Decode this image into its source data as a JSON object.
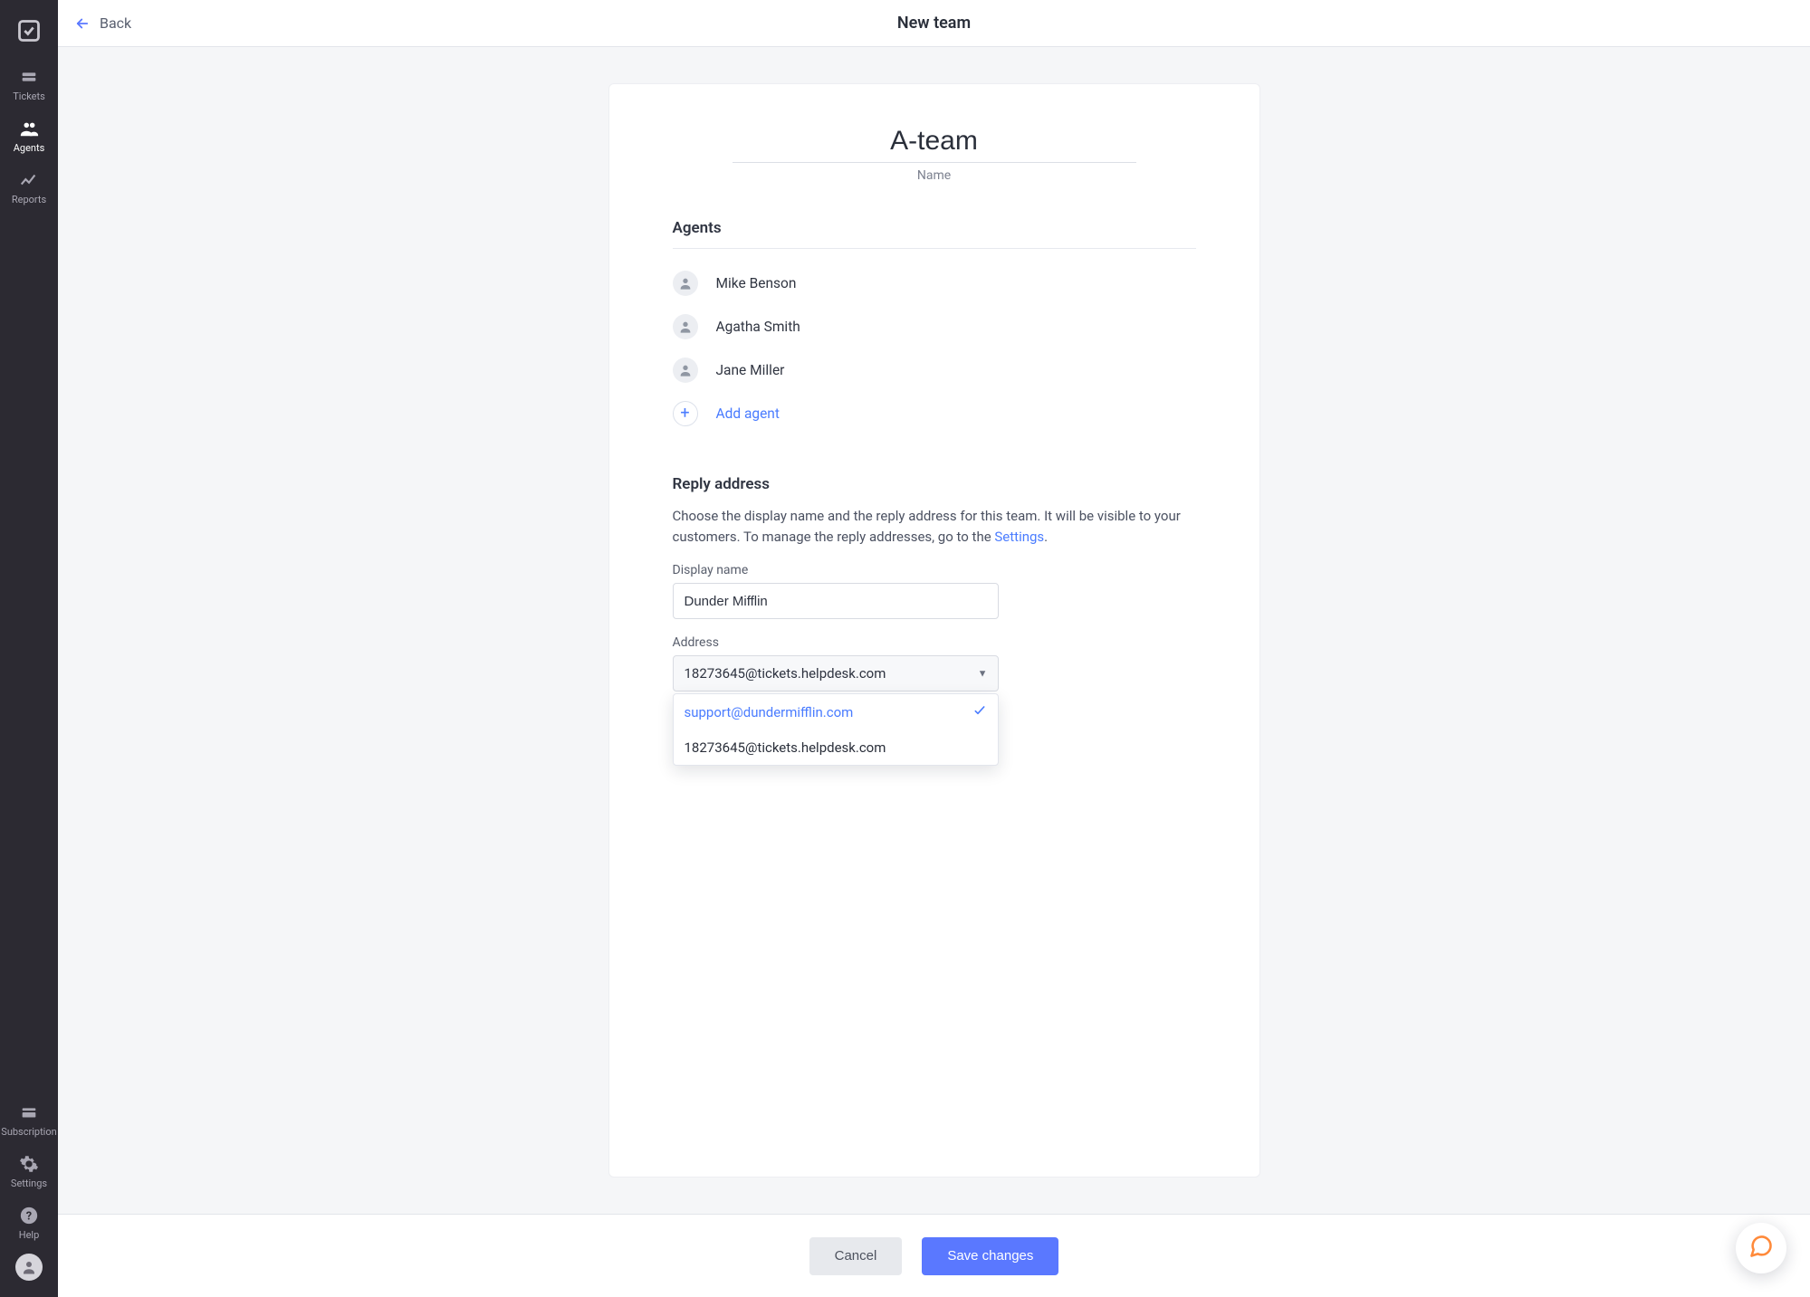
{
  "sidebar": {
    "items": [
      {
        "label": "Tickets"
      },
      {
        "label": "Agents"
      },
      {
        "label": "Reports"
      }
    ],
    "bottom_items": [
      {
        "label": "Subscription"
      },
      {
        "label": "Settings"
      },
      {
        "label": "Help"
      }
    ]
  },
  "header": {
    "back_label": "Back",
    "title": "New team"
  },
  "team": {
    "name_value": "A-team",
    "name_label": "Name"
  },
  "agents_section": {
    "title": "Agents",
    "add_label": "Add agent",
    "list": [
      {
        "name": "Mike Benson"
      },
      {
        "name": "Agatha Smith"
      },
      {
        "name": "Jane Miller"
      }
    ]
  },
  "reply_section": {
    "title": "Reply address",
    "description_prefix": "Choose the display name and the reply address for this team. It will be visible to your customers. To manage the reply addresses, go to the ",
    "description_link": "Settings",
    "description_suffix": ".",
    "display_name_label": "Display name",
    "display_name_value": "Dunder Mifflin",
    "address_label": "Address",
    "address_selected": "18273645@tickets.helpdesk.com",
    "address_options": [
      {
        "value": "support@dundermifflin.com",
        "selected": true
      },
      {
        "value": "18273645@tickets.helpdesk.com",
        "selected": false
      }
    ]
  },
  "footer": {
    "cancel_label": "Cancel",
    "save_label": "Save changes"
  }
}
